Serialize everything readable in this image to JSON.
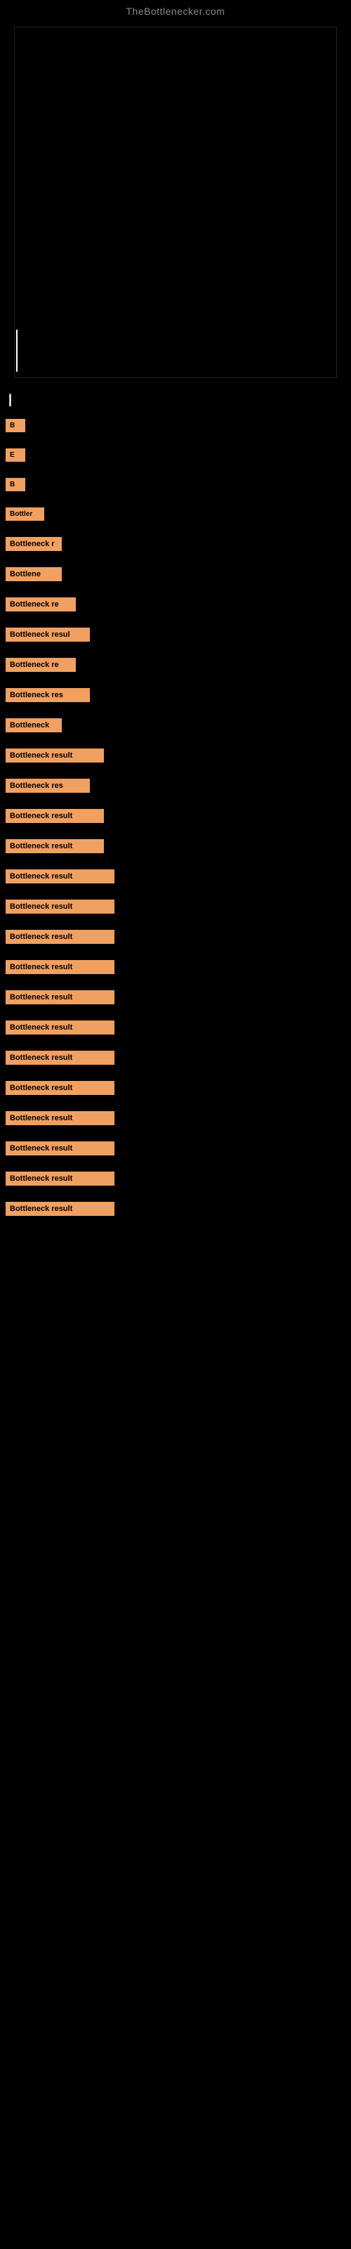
{
  "site": {
    "title": "TheBottlenecker.com"
  },
  "section": {
    "label": "|"
  },
  "results": [
    {
      "id": 1,
      "text": "B",
      "size": "badge-xs"
    },
    {
      "id": 2,
      "text": "E",
      "size": "badge-xs"
    },
    {
      "id": 3,
      "text": "B",
      "size": "badge-xs"
    },
    {
      "id": 4,
      "text": "Bottler",
      "size": "badge-md"
    },
    {
      "id": 5,
      "text": "Bottleneck r",
      "size": "badge-lg"
    },
    {
      "id": 6,
      "text": "Bottlene",
      "size": "badge-lg"
    },
    {
      "id": 7,
      "text": "Bottleneck re",
      "size": "badge-xl"
    },
    {
      "id": 8,
      "text": "Bottleneck resul",
      "size": "badge-xxl"
    },
    {
      "id": 9,
      "text": "Bottleneck re",
      "size": "badge-xl"
    },
    {
      "id": 10,
      "text": "Bottleneck res",
      "size": "badge-xxl"
    },
    {
      "id": 11,
      "text": "Bottleneck",
      "size": "badge-lg"
    },
    {
      "id": 12,
      "text": "Bottleneck result",
      "size": "badge-xxxl"
    },
    {
      "id": 13,
      "text": "Bottleneck res",
      "size": "badge-xxl"
    },
    {
      "id": 14,
      "text": "Bottleneck result",
      "size": "badge-xxxl"
    },
    {
      "id": 15,
      "text": "Bottleneck result",
      "size": "badge-xxxl"
    },
    {
      "id": 16,
      "text": "Bottleneck result",
      "size": "badge-full"
    },
    {
      "id": 17,
      "text": "Bottleneck result",
      "size": "badge-full"
    },
    {
      "id": 18,
      "text": "Bottleneck result",
      "size": "badge-full"
    },
    {
      "id": 19,
      "text": "Bottleneck result",
      "size": "badge-full"
    },
    {
      "id": 20,
      "text": "Bottleneck result",
      "size": "badge-full"
    },
    {
      "id": 21,
      "text": "Bottleneck result",
      "size": "badge-full"
    },
    {
      "id": 22,
      "text": "Bottleneck result",
      "size": "badge-full"
    },
    {
      "id": 23,
      "text": "Bottleneck result",
      "size": "badge-full"
    },
    {
      "id": 24,
      "text": "Bottleneck result",
      "size": "badge-full"
    },
    {
      "id": 25,
      "text": "Bottleneck result",
      "size": "badge-full"
    },
    {
      "id": 26,
      "text": "Bottleneck result",
      "size": "badge-full"
    },
    {
      "id": 27,
      "text": "Bottleneck result",
      "size": "badge-full"
    }
  ]
}
